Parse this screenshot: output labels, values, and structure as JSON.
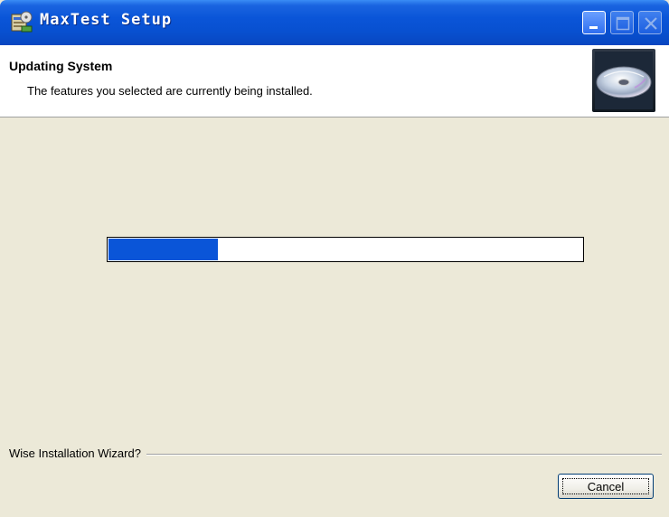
{
  "window": {
    "title": "MaxTest Setup"
  },
  "header": {
    "title": "Updating System",
    "description": "The features you selected are currently being installed.",
    "image": "cd-icon"
  },
  "progress": {
    "fraction": 0.23,
    "fill_color": "#0a55d8"
  },
  "footer": {
    "label": "Wise Installation Wizard?",
    "cancel_label": "Cancel"
  },
  "icons": {
    "app": "installer-icon",
    "minimize": "minimize-icon",
    "maximize": "maximize-icon",
    "close": "close-icon"
  },
  "colors": {
    "titlebar": "#0a55d8",
    "dialog_background": "#ece9d8"
  }
}
